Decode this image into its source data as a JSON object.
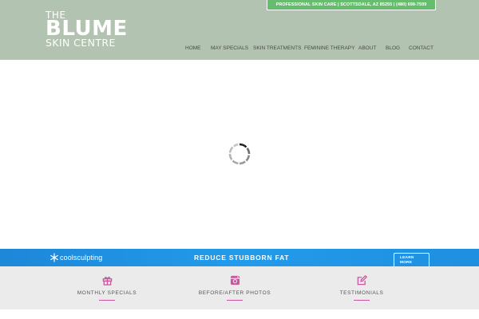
{
  "logo": {
    "line1": "THE",
    "line2": "BLUME",
    "line3": "SKIN CENTRE"
  },
  "topbar": {
    "text": "PROFESSIONAL SKIN CARE | SCOTTSDALE, AZ 85255 | (480) 699-7599"
  },
  "nav": {
    "items": [
      {
        "label": "HOME"
      },
      {
        "label": "MAY SPECIALS"
      },
      {
        "label": "SKIN TREATMENTS"
      },
      {
        "label": "FEMININE THERAPY"
      },
      {
        "label": "ABOUT"
      },
      {
        "label": "BLOG"
      },
      {
        "label": "CONTACT"
      }
    ]
  },
  "banner": {
    "brand": "coolsculpting",
    "headline": "REDUCE STUBBORN FAT",
    "cta_line1": "LEARN",
    "cta_line2": "MORE"
  },
  "features": [
    {
      "label": "MONTHLY SPECIALS",
      "icon": "gift-icon"
    },
    {
      "label": "BEFORE/AFTER PHOTOS",
      "icon": "instagram-icon"
    },
    {
      "label": "TESTIMONIALS",
      "icon": "edit-icon"
    }
  ],
  "colors": {
    "header_bg": "#b3c3b1",
    "topbar_bg": "#67bd6e",
    "banner_blue": "#1f8fe0",
    "accent_pink": "#c8579f",
    "feature_bg": "#ebebeb"
  }
}
